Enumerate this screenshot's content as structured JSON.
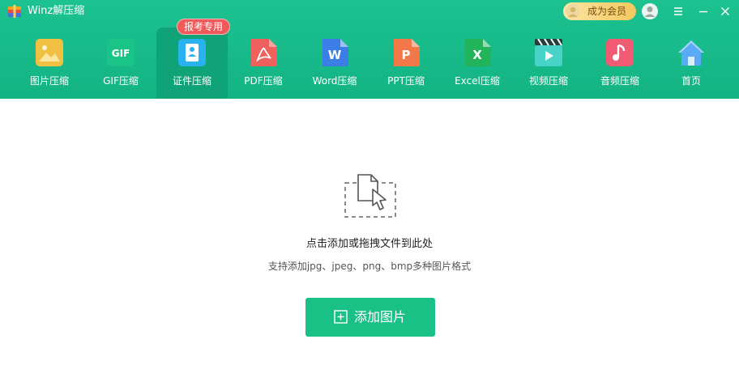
{
  "app": {
    "title": "Winz解压缩"
  },
  "titlebar": {
    "vip_label": "成为会员",
    "icons": [
      "user-icon",
      "menu-icon",
      "minimize-icon",
      "close-icon"
    ]
  },
  "nav": {
    "badge": "报考专用",
    "items": [
      {
        "label": "图片压缩",
        "icon": "image-icon",
        "color": "#f0c043"
      },
      {
        "label": "GIF压缩",
        "icon": "gif-icon",
        "color": "#19c486",
        "text": "GIF"
      },
      {
        "label": "证件压缩",
        "icon": "id-card-icon",
        "color": "#28b2ef",
        "active": true
      },
      {
        "label": "PDF压缩",
        "icon": "pdf-icon",
        "color": "#f0605d"
      },
      {
        "label": "Word压缩",
        "icon": "word-icon",
        "color": "#3b7fe6",
        "text": "W"
      },
      {
        "label": "PPT压缩",
        "icon": "ppt-icon",
        "color": "#f2784a",
        "text": "P"
      },
      {
        "label": "Excel压缩",
        "icon": "excel-icon",
        "color": "#22b35b",
        "text": "X"
      },
      {
        "label": "视频压缩",
        "icon": "video-icon",
        "color": "#47d3c7"
      },
      {
        "label": "音频压缩",
        "icon": "audio-icon",
        "color": "#f05a73"
      },
      {
        "label": "首页",
        "icon": "home-icon",
        "color": "#5aaaf6"
      }
    ]
  },
  "drop": {
    "title": "点击添加或拖拽文件到此处",
    "hint": "支持添加jpg、jpeg、png、bmp多种图片格式",
    "button_label": "添加图片"
  }
}
